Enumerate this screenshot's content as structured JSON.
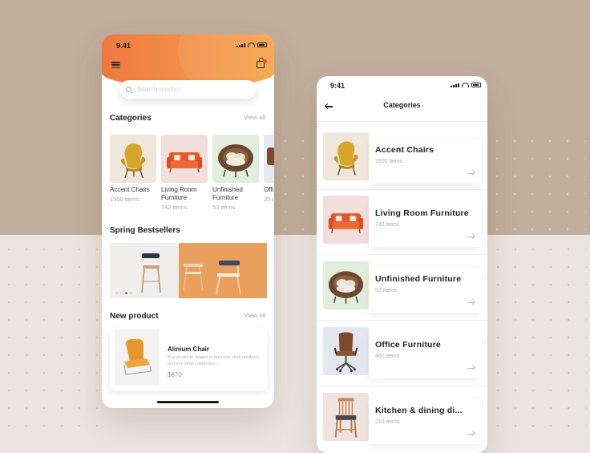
{
  "colors": {
    "accent": "#ee7a40",
    "accent_light": "#f6a447",
    "background_top": "#c2ae9d",
    "background_bottom": "#ede5e1",
    "dot_active": "#e4543a"
  },
  "home_screen": {
    "status_time": "9:41",
    "search": {
      "placeholder": "Search product",
      "value": ""
    },
    "categories": {
      "title": "Categories",
      "view_all": "View all",
      "items": [
        {
          "name": "Accent Chairs",
          "count": "1500 items",
          "icon": "accent-chair"
        },
        {
          "name": "Living Room Furniture",
          "count": "742 items",
          "icon": "sofa"
        },
        {
          "name": "Unfinished Furniture",
          "count": "53 items",
          "icon": "rattan-chair"
        },
        {
          "name": "Offi",
          "count": "35 i",
          "icon": "office-chair"
        }
      ]
    },
    "bestsellers": {
      "title": "Spring Bestsellers",
      "slide_count": 4,
      "active_slide": 3
    },
    "new_product": {
      "title": "New product",
      "view_all": "View all",
      "product": {
        "name": "Alinium Chair",
        "description": "Buy products related to lazy boy chair products and see what customers...",
        "price": "$870"
      }
    }
  },
  "categories_screen": {
    "status_time": "9:41",
    "title": "Categories",
    "items": [
      {
        "name": "Accent Chairs",
        "count": "1500 items",
        "icon": "accent-chair"
      },
      {
        "name": "Living Room Furniture",
        "count": "742 items",
        "icon": "sofa"
      },
      {
        "name": "Unfinished Furniture",
        "count": "53 items",
        "icon": "rattan-chair"
      },
      {
        "name": "Office Furniture",
        "count": "460 items",
        "icon": "office-chair"
      },
      {
        "name": "Kitchen & dining di...",
        "count": "210 items",
        "icon": "dining-chair"
      }
    ]
  }
}
